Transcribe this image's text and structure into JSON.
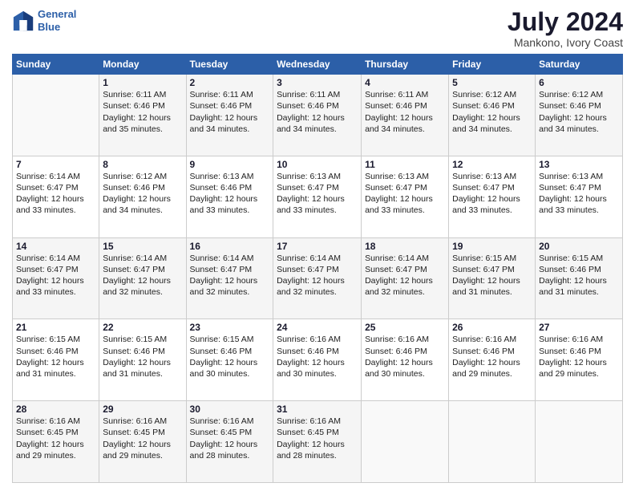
{
  "header": {
    "logo_line1": "General",
    "logo_line2": "Blue",
    "title": "July 2024",
    "subtitle": "Mankono, Ivory Coast"
  },
  "weekdays": [
    "Sunday",
    "Monday",
    "Tuesday",
    "Wednesday",
    "Thursday",
    "Friday",
    "Saturday"
  ],
  "weeks": [
    [
      {
        "day": "",
        "info": ""
      },
      {
        "day": "1",
        "info": "Sunrise: 6:11 AM\nSunset: 6:46 PM\nDaylight: 12 hours\nand 35 minutes."
      },
      {
        "day": "2",
        "info": "Sunrise: 6:11 AM\nSunset: 6:46 PM\nDaylight: 12 hours\nand 34 minutes."
      },
      {
        "day": "3",
        "info": "Sunrise: 6:11 AM\nSunset: 6:46 PM\nDaylight: 12 hours\nand 34 minutes."
      },
      {
        "day": "4",
        "info": "Sunrise: 6:11 AM\nSunset: 6:46 PM\nDaylight: 12 hours\nand 34 minutes."
      },
      {
        "day": "5",
        "info": "Sunrise: 6:12 AM\nSunset: 6:46 PM\nDaylight: 12 hours\nand 34 minutes."
      },
      {
        "day": "6",
        "info": "Sunrise: 6:12 AM\nSunset: 6:46 PM\nDaylight: 12 hours\nand 34 minutes."
      }
    ],
    [
      {
        "day": "7",
        "info": ""
      },
      {
        "day": "8",
        "info": "Sunrise: 6:12 AM\nSunset: 6:46 PM\nDaylight: 12 hours\nand 34 minutes."
      },
      {
        "day": "9",
        "info": "Sunrise: 6:13 AM\nSunset: 6:46 PM\nDaylight: 12 hours\nand 33 minutes."
      },
      {
        "day": "10",
        "info": "Sunrise: 6:13 AM\nSunset: 6:47 PM\nDaylight: 12 hours\nand 33 minutes."
      },
      {
        "day": "11",
        "info": "Sunrise: 6:13 AM\nSunset: 6:47 PM\nDaylight: 12 hours\nand 33 minutes."
      },
      {
        "day": "12",
        "info": "Sunrise: 6:13 AM\nSunset: 6:47 PM\nDaylight: 12 hours\nand 33 minutes."
      },
      {
        "day": "13",
        "info": "Sunrise: 6:13 AM\nSunset: 6:47 PM\nDaylight: 12 hours\nand 33 minutes."
      }
    ],
    [
      {
        "day": "14",
        "info": ""
      },
      {
        "day": "15",
        "info": "Sunrise: 6:14 AM\nSunset: 6:47 PM\nDaylight: 12 hours\nand 32 minutes."
      },
      {
        "day": "16",
        "info": "Sunrise: 6:14 AM\nSunset: 6:47 PM\nDaylight: 12 hours\nand 32 minutes."
      },
      {
        "day": "17",
        "info": "Sunrise: 6:14 AM\nSunset: 6:47 PM\nDaylight: 12 hours\nand 32 minutes."
      },
      {
        "day": "18",
        "info": "Sunrise: 6:14 AM\nSunset: 6:47 PM\nDaylight: 12 hours\nand 32 minutes."
      },
      {
        "day": "19",
        "info": "Sunrise: 6:15 AM\nSunset: 6:47 PM\nDaylight: 12 hours\nand 31 minutes."
      },
      {
        "day": "20",
        "info": "Sunrise: 6:15 AM\nSunset: 6:46 PM\nDaylight: 12 hours\nand 31 minutes."
      }
    ],
    [
      {
        "day": "21",
        "info": ""
      },
      {
        "day": "22",
        "info": "Sunrise: 6:15 AM\nSunset: 6:46 PM\nDaylight: 12 hours\nand 31 minutes."
      },
      {
        "day": "23",
        "info": "Sunrise: 6:15 AM\nSunset: 6:46 PM\nDaylight: 12 hours\nand 30 minutes."
      },
      {
        "day": "24",
        "info": "Sunrise: 6:16 AM\nSunset: 6:46 PM\nDaylight: 12 hours\nand 30 minutes."
      },
      {
        "day": "25",
        "info": "Sunrise: 6:16 AM\nSunset: 6:46 PM\nDaylight: 12 hours\nand 30 minutes."
      },
      {
        "day": "26",
        "info": "Sunrise: 6:16 AM\nSunset: 6:46 PM\nDaylight: 12 hours\nand 29 minutes."
      },
      {
        "day": "27",
        "info": "Sunrise: 6:16 AM\nSunset: 6:46 PM\nDaylight: 12 hours\nand 29 minutes."
      }
    ],
    [
      {
        "day": "28",
        "info": "Sunrise: 6:16 AM\nSunset: 6:45 PM\nDaylight: 12 hours\nand 29 minutes."
      },
      {
        "day": "29",
        "info": "Sunrise: 6:16 AM\nSunset: 6:45 PM\nDaylight: 12 hours\nand 29 minutes."
      },
      {
        "day": "30",
        "info": "Sunrise: 6:16 AM\nSunset: 6:45 PM\nDaylight: 12 hours\nand 28 minutes."
      },
      {
        "day": "31",
        "info": "Sunrise: 6:16 AM\nSunset: 6:45 PM\nDaylight: 12 hours\nand 28 minutes."
      },
      {
        "day": "",
        "info": ""
      },
      {
        "day": "",
        "info": ""
      },
      {
        "day": "",
        "info": ""
      }
    ]
  ],
  "week1_sun_info": "Sunrise: 6:14 AM\nSunset: 6:47 PM\nDaylight: 12 hours\nand 33 minutes.",
  "week3_sun_info": "Sunrise: 6:14 AM\nSunset: 6:47 PM\nDaylight: 12 hours\nand 33 minutes.",
  "week4_sun_info": "Sunrise: 6:15 AM\nSunset: 6:46 PM\nDaylight: 12 hours\nand 31 minutes."
}
